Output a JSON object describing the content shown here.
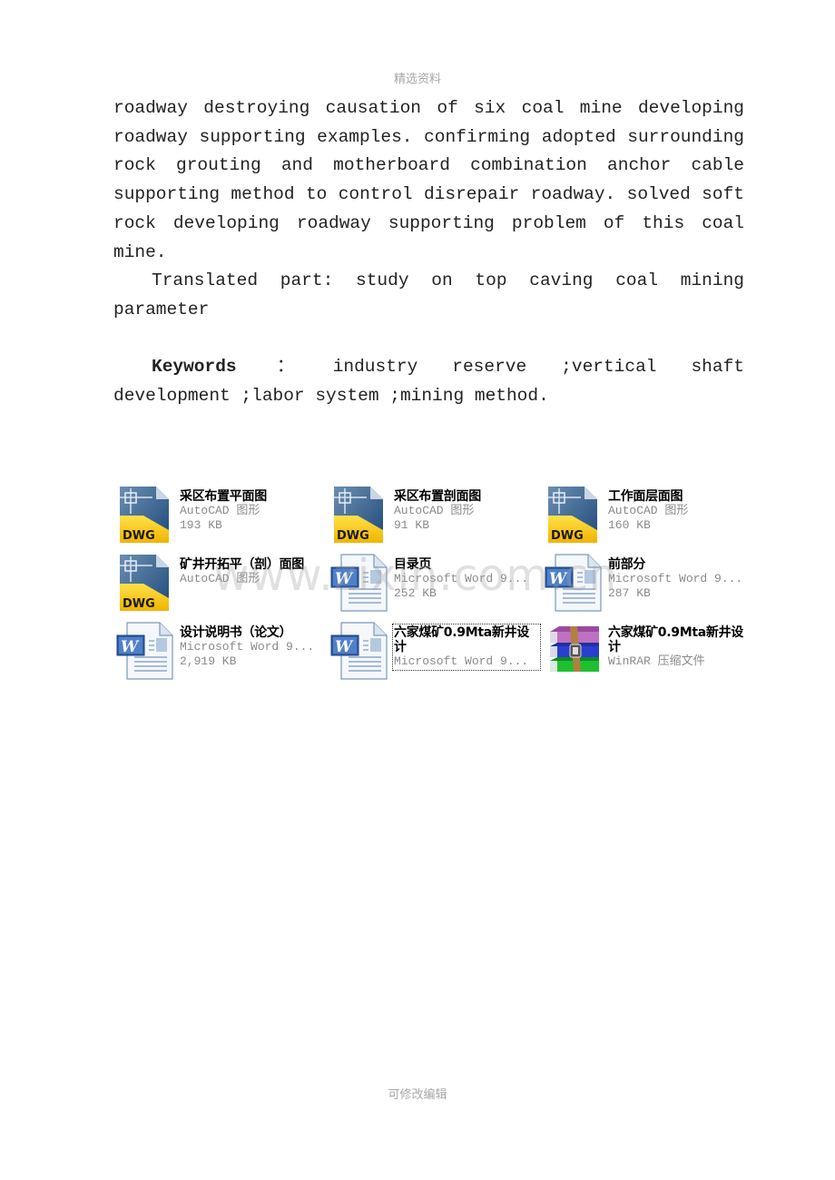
{
  "page": {
    "header": "精选资料",
    "footer": "可修改编辑"
  },
  "abstract": {
    "paragraph1": "roadway destroying causation of six coal mine developing roadway supporting examples. confirming adopted surrounding rock grouting and motherboard combination anchor cable supporting method to control disrepair roadway. solved soft rock developing roadway supporting problem of this coal mine.",
    "paragraph2": "Translated part: study on top caving coal mining parameter",
    "keywords_label": "Keywords",
    "keywords_colon": "：",
    "keywords_text": "industry reserve ;vertical shaft development ;labor system ;mining method."
  },
  "watermark": "www.zixin.com.cn",
  "files": [
    {
      "name": "采区布置平面图",
      "type": "AutoCAD 图形",
      "size": "193 KB",
      "icon": "dwg-file-icon",
      "selected": false
    },
    {
      "name": "采区布置剖面图",
      "type": "AutoCAD 图形",
      "size": "91 KB",
      "icon": "dwg-file-icon",
      "selected": false
    },
    {
      "name": "工作面层面图",
      "type": "AutoCAD 图形",
      "size": "160 KB",
      "icon": "dwg-file-icon",
      "selected": false
    },
    {
      "name": "矿井开拓平（剖）面图",
      "type": "AutoCAD 图形",
      "size": "",
      "icon": "dwg-file-icon",
      "selected": false
    },
    {
      "name": "目录页",
      "type": "Microsoft Word 9...",
      "size": "252 KB",
      "icon": "word-doc-icon",
      "selected": false
    },
    {
      "name": "前部分",
      "type": "Microsoft Word 9...",
      "size": "287 KB",
      "icon": "word-doc-icon",
      "selected": false
    },
    {
      "name": "设计说明书（论文）",
      "type": "Microsoft Word 9...",
      "size": "2,919 KB",
      "icon": "word-doc-icon",
      "selected": false
    },
    {
      "name": "六家煤矿0.9Mta新井设计",
      "type": "Microsoft Word 9...",
      "size": "",
      "icon": "word-doc-icon",
      "selected": true
    },
    {
      "name": "六家煤矿0.9Mta新井设计",
      "type": "WinRAR 压缩文件",
      "size": "",
      "icon": "winrar-archive-icon",
      "selected": false
    }
  ]
}
